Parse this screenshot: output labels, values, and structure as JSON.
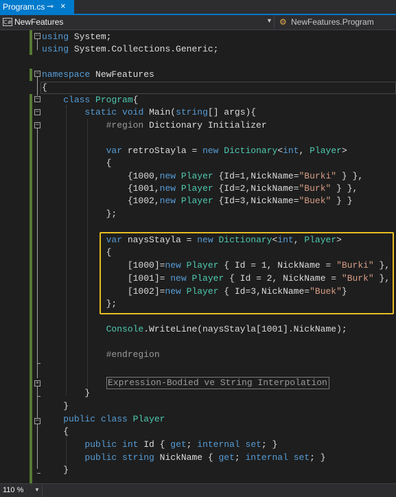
{
  "tab": {
    "title": "Program.cs",
    "pin_glyph": "⊸",
    "close_glyph": "×"
  },
  "navbar": {
    "project": "NewFeatures",
    "cs_badge": "C#",
    "dropdown_glyph": "▼",
    "class_icon": "⚙",
    "class_path": "NewFeatures.Program"
  },
  "code": {
    "lines": [
      [
        [
          "kw",
          "using"
        ],
        [
          "pl",
          " System;"
        ]
      ],
      [
        [
          "kw",
          "using"
        ],
        [
          "pl",
          " System.Collections.Generic;"
        ]
      ],
      [],
      [
        [
          "kw",
          "namespace"
        ],
        [
          "pl",
          " NewFeatures"
        ]
      ],
      [
        [
          "pl",
          "{"
        ]
      ],
      [
        [
          "pl",
          "    "
        ],
        [
          "kw",
          "class"
        ],
        [
          "pl",
          " "
        ],
        [
          "ty",
          "Program"
        ],
        [
          "pl",
          "{"
        ]
      ],
      [
        [
          "pl",
          "        "
        ],
        [
          "kw",
          "static"
        ],
        [
          "pl",
          " "
        ],
        [
          "kw",
          "void"
        ],
        [
          "pl",
          " Main("
        ],
        [
          "kw",
          "string"
        ],
        [
          "pl",
          "[] args){"
        ]
      ],
      [
        [
          "pl",
          "            "
        ],
        [
          "pp",
          "#region"
        ],
        [
          "pl",
          " Dictionary Initializer"
        ]
      ],
      [],
      [
        [
          "pl",
          "            "
        ],
        [
          "kw",
          "var"
        ],
        [
          "pl",
          " retroStayla = "
        ],
        [
          "kw",
          "new"
        ],
        [
          "pl",
          " "
        ],
        [
          "ty",
          "Dictionary"
        ],
        [
          "pl",
          "<"
        ],
        [
          "kw",
          "int"
        ],
        [
          "pl",
          ", "
        ],
        [
          "ty",
          "Player"
        ],
        [
          "pl",
          ">"
        ]
      ],
      [
        [
          "pl",
          "            {"
        ]
      ],
      [
        [
          "pl",
          "                {1000,"
        ],
        [
          "kw",
          "new"
        ],
        [
          "pl",
          " "
        ],
        [
          "ty",
          "Player"
        ],
        [
          "pl",
          " {Id=1,NickName="
        ],
        [
          "st",
          "\"Burki\""
        ],
        [
          "pl",
          " } },"
        ]
      ],
      [
        [
          "pl",
          "                {1001,"
        ],
        [
          "kw",
          "new"
        ],
        [
          "pl",
          " "
        ],
        [
          "ty",
          "Player"
        ],
        [
          "pl",
          " {Id=2,NickName="
        ],
        [
          "st",
          "\"Burk\""
        ],
        [
          "pl",
          " } },"
        ]
      ],
      [
        [
          "pl",
          "                {1002,"
        ],
        [
          "kw",
          "new"
        ],
        [
          "pl",
          " "
        ],
        [
          "ty",
          "Player"
        ],
        [
          "pl",
          " {Id=3,NickName="
        ],
        [
          "st",
          "\"Buek\""
        ],
        [
          "pl",
          " } }"
        ]
      ],
      [
        [
          "pl",
          "            };"
        ]
      ],
      [],
      [
        [
          "pl",
          "            "
        ],
        [
          "kw",
          "var"
        ],
        [
          "pl",
          " naysStayla = "
        ],
        [
          "kw",
          "new"
        ],
        [
          "pl",
          " "
        ],
        [
          "ty",
          "Dictionary"
        ],
        [
          "pl",
          "<"
        ],
        [
          "kw",
          "int"
        ],
        [
          "pl",
          ", "
        ],
        [
          "ty",
          "Player"
        ],
        [
          "pl",
          ">"
        ]
      ],
      [
        [
          "pl",
          "            {"
        ]
      ],
      [
        [
          "pl",
          "                [1000]="
        ],
        [
          "kw",
          "new"
        ],
        [
          "pl",
          " "
        ],
        [
          "ty",
          "Player"
        ],
        [
          "pl",
          " { Id = 1, NickName = "
        ],
        [
          "st",
          "\"Burki\""
        ],
        [
          "pl",
          " },"
        ]
      ],
      [
        [
          "pl",
          "                [1001]= "
        ],
        [
          "kw",
          "new"
        ],
        [
          "pl",
          " "
        ],
        [
          "ty",
          "Player"
        ],
        [
          "pl",
          " { Id = 2, NickName = "
        ],
        [
          "st",
          "\"Burk\""
        ],
        [
          "pl",
          " },"
        ]
      ],
      [
        [
          "pl",
          "                [1002]="
        ],
        [
          "kw",
          "new"
        ],
        [
          "pl",
          " "
        ],
        [
          "ty",
          "Player"
        ],
        [
          "pl",
          " { Id=3,NickName="
        ],
        [
          "st",
          "\"Buek\""
        ],
        [
          "pl",
          "}"
        ]
      ],
      [
        [
          "pl",
          "            };"
        ]
      ],
      [],
      [
        [
          "pl",
          "            "
        ],
        [
          "ty",
          "Console"
        ],
        [
          "pl",
          ".WriteLine(naysStayla[1001].NickName);"
        ]
      ],
      [],
      [
        [
          "pl",
          "            "
        ],
        [
          "pp",
          "#endregion"
        ]
      ],
      [],
      [],
      [
        [
          "pl",
          "        }"
        ]
      ],
      [
        [
          "pl",
          "    }"
        ]
      ],
      [
        [
          "pl",
          "    "
        ],
        [
          "kw",
          "public"
        ],
        [
          "pl",
          " "
        ],
        [
          "kw",
          "class"
        ],
        [
          "pl",
          " "
        ],
        [
          "ty",
          "Player"
        ]
      ],
      [
        [
          "pl",
          "    {"
        ]
      ],
      [
        [
          "pl",
          "        "
        ],
        [
          "kw",
          "public"
        ],
        [
          "pl",
          " "
        ],
        [
          "kw",
          "int"
        ],
        [
          "pl",
          " Id { "
        ],
        [
          "kw",
          "get"
        ],
        [
          "pl",
          "; "
        ],
        [
          "kw",
          "internal"
        ],
        [
          "pl",
          " "
        ],
        [
          "kw",
          "set"
        ],
        [
          "pl",
          "; }"
        ]
      ],
      [
        [
          "pl",
          "        "
        ],
        [
          "kw",
          "public"
        ],
        [
          "pl",
          " "
        ],
        [
          "kw",
          "string"
        ],
        [
          "pl",
          " NickName { "
        ],
        [
          "kw",
          "get"
        ],
        [
          "pl",
          "; "
        ],
        [
          "kw",
          "internal"
        ],
        [
          "pl",
          " "
        ],
        [
          "kw",
          "set"
        ],
        [
          "pl",
          "; }"
        ]
      ],
      [
        [
          "pl",
          "    }"
        ]
      ]
    ],
    "collapsed_region_label": "Expression-Bodied ve String Interpolation"
  },
  "status": {
    "zoom": "110 %",
    "zoom_arrow": "▼"
  }
}
